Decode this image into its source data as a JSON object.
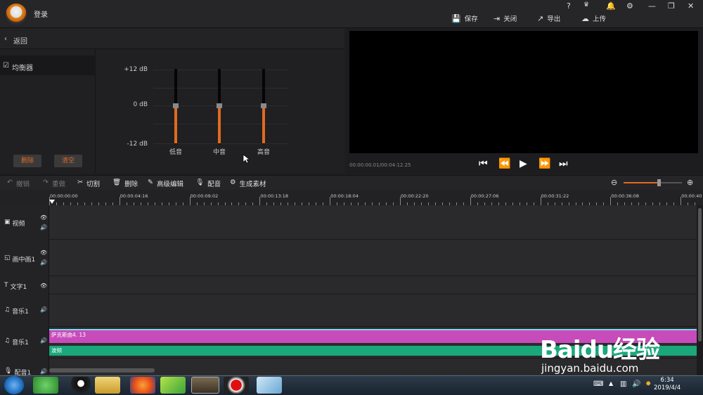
{
  "titlebar": {
    "login": "登录",
    "help": "?",
    "notify": "🔔",
    "settings": "⚙",
    "minimize": "—",
    "restore": "❐",
    "close": "✕",
    "buttons": [
      {
        "label": "保存",
        "icon": "save-icon"
      },
      {
        "label": "关闭",
        "icon": "exit-icon"
      },
      {
        "label": "导出",
        "icon": "export-icon"
      },
      {
        "label": "上传",
        "icon": "upload-icon"
      }
    ]
  },
  "left": {
    "back": "返回",
    "eq_item": "均衡器",
    "delete": "删除",
    "clear": "清空"
  },
  "eq": {
    "db_top": "+12 dB",
    "db_mid": "0 dB",
    "db_bot": "-12 dB",
    "bands": [
      "低音",
      "中音",
      "高音"
    ],
    "values_db": [
      0,
      0,
      0
    ]
  },
  "preview": {
    "timecode": "00:00:00.01/00:04:12.25"
  },
  "toolbar": {
    "undo": "撤销",
    "redo": "重做",
    "cut": "切割",
    "delete": "删除",
    "advanced": "高级编辑",
    "dub": "配音",
    "generate": "生成素材",
    "zoom": 0.6
  },
  "ruler": {
    "ticks": [
      "00:00:00:00",
      "00:00:04:16",
      "00:00:09:02",
      "00:00:13:18",
      "00:00:18:04",
      "00:00:22:20",
      "00:00:27:06",
      "00:00:31:22",
      "00:00:36:08",
      "00:00:40"
    ]
  },
  "tracks": {
    "video": "视频",
    "pip": "画中画1",
    "text": "文字1",
    "music1": "音乐1",
    "music2": "音乐1",
    "dub": "配音1"
  },
  "clips": {
    "music": "萨克斯曲4. 13",
    "wave": "波频"
  },
  "taskbar": {
    "time": "6:34",
    "date": "2019/4/4"
  },
  "watermark": {
    "brand": "Baidu经验",
    "url": "jingyan.baidu.com"
  }
}
